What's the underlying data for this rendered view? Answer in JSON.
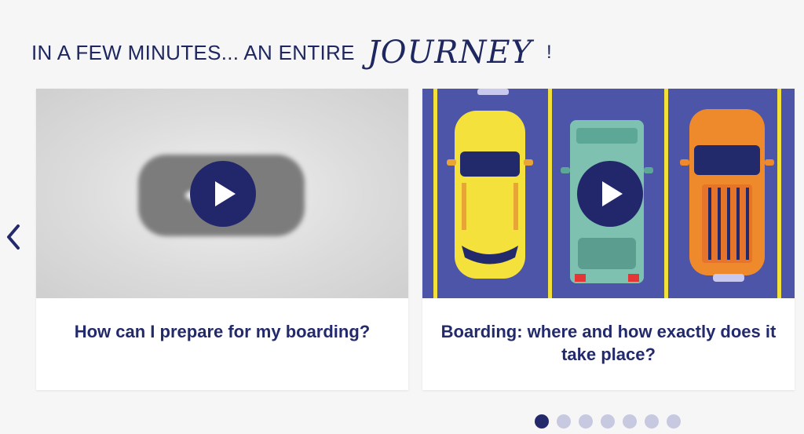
{
  "heading": {
    "main": "IN A FEW MINUTES... AN ENTIRE",
    "accent": "JOURNEY",
    "end": "!"
  },
  "carousel": {
    "prev_icon": "chevron-left-icon",
    "cards": [
      {
        "title": "How can I prepare for my boarding?",
        "play_icon": "play-icon"
      },
      {
        "title": "Boarding: where and how exactly does it take place?",
        "play_icon": "play-icon"
      }
    ],
    "dots": {
      "total": 7,
      "active_index": 0
    }
  },
  "colors": {
    "brand_navy": "#22276b",
    "parking_blue": "#4d55a9",
    "dot_inactive": "#c6c9e0",
    "lane_yellow": "#f4e03a"
  }
}
